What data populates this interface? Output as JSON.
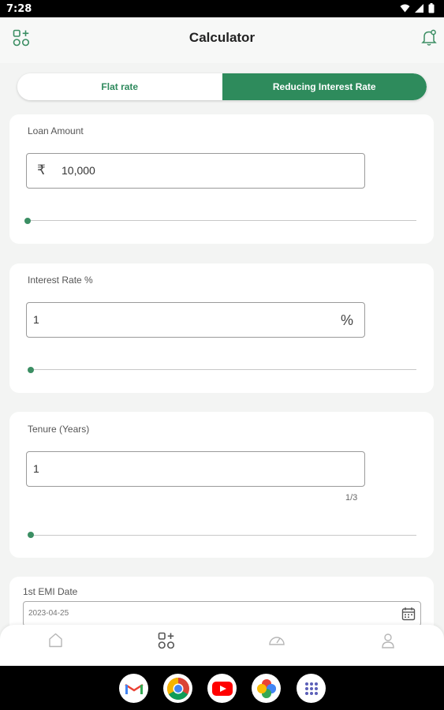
{
  "status_bar": {
    "time": "7:28"
  },
  "header": {
    "title": "Calculator"
  },
  "toggle": {
    "flat_label": "Flat rate",
    "reducing_label": "Reducing Interest Rate"
  },
  "loan": {
    "label": "Loan Amount",
    "currency": "₹",
    "value": "10,000",
    "slider_fraction": 0
  },
  "interest": {
    "label": "Interest Rate %",
    "value": "1",
    "suffix": "%",
    "slider_fraction": 0
  },
  "tenure": {
    "label": "Tenure (Years)",
    "value": "1",
    "counter": "1/3",
    "slider_fraction": 0
  },
  "emi": {
    "label": "1st EMI Date",
    "value": "2023-04-25"
  },
  "bottom_nav": {
    "items": [
      "home-icon",
      "calculator-icon",
      "speedometer-icon",
      "profile-icon"
    ],
    "active_index": 1
  },
  "dock": {
    "apps": [
      "gmail-icon",
      "chrome-icon",
      "youtube-icon",
      "photos-icon",
      "apps-drawer-icon"
    ]
  },
  "colors": {
    "accent": "#2e8b5c",
    "slider": "#3b8e63",
    "background": "#f3f4f3"
  }
}
